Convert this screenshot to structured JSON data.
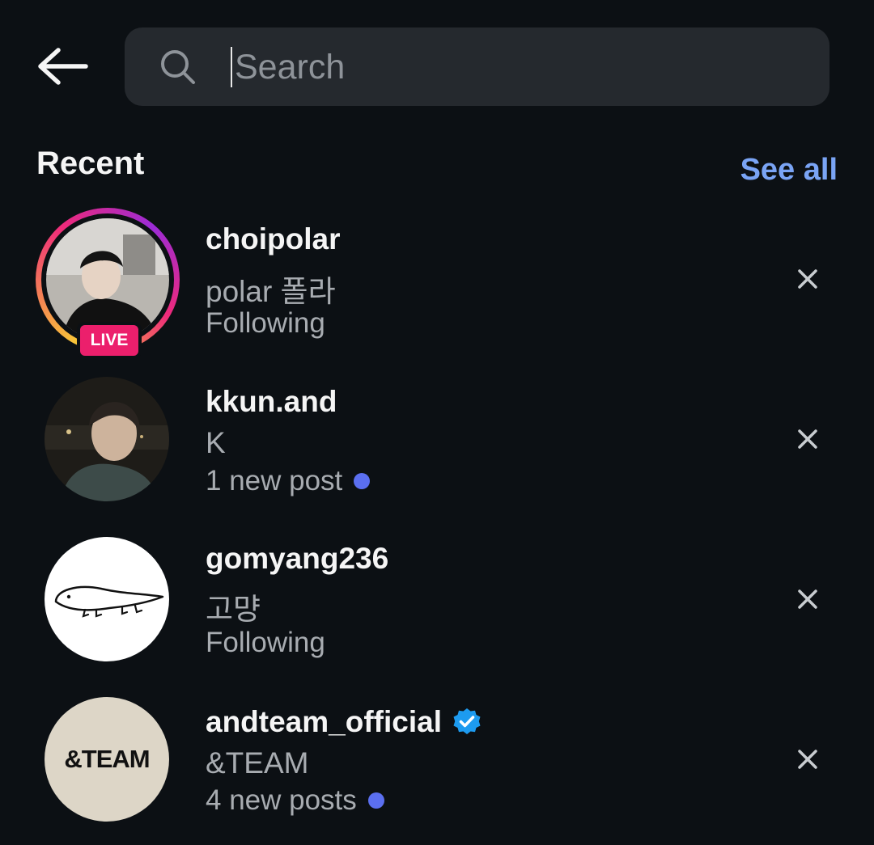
{
  "header": {
    "back_icon": "arrow-left-icon",
    "search": {
      "placeholder": "Search",
      "value": "",
      "icon": "search-icon"
    }
  },
  "recent": {
    "heading": "Recent",
    "see_all": "See all",
    "items": [
      {
        "username": "choipolar",
        "fullname": "polar 폴라",
        "status": "Following",
        "live_badge": "LIVE",
        "verified": false,
        "unread_dot": false
      },
      {
        "username": "kkun.and",
        "fullname": "K",
        "status": "1 new post",
        "verified": false,
        "unread_dot": true
      },
      {
        "username": "gomyang236",
        "fullname": "고먕",
        "status": "Following",
        "verified": false,
        "unread_dot": false
      },
      {
        "username": "andteam_official",
        "fullname": "&TEAM",
        "status": "4 new posts",
        "verified": true,
        "unread_dot": true,
        "avatar_text": "&TEAM"
      }
    ]
  },
  "colors": {
    "background": "#0c1014",
    "search_bg": "#25292e",
    "link": "#7aa4f5",
    "live": "#ec1f6c",
    "unread_dot": "#5b6ff0",
    "verified": "#1d9bf0"
  }
}
